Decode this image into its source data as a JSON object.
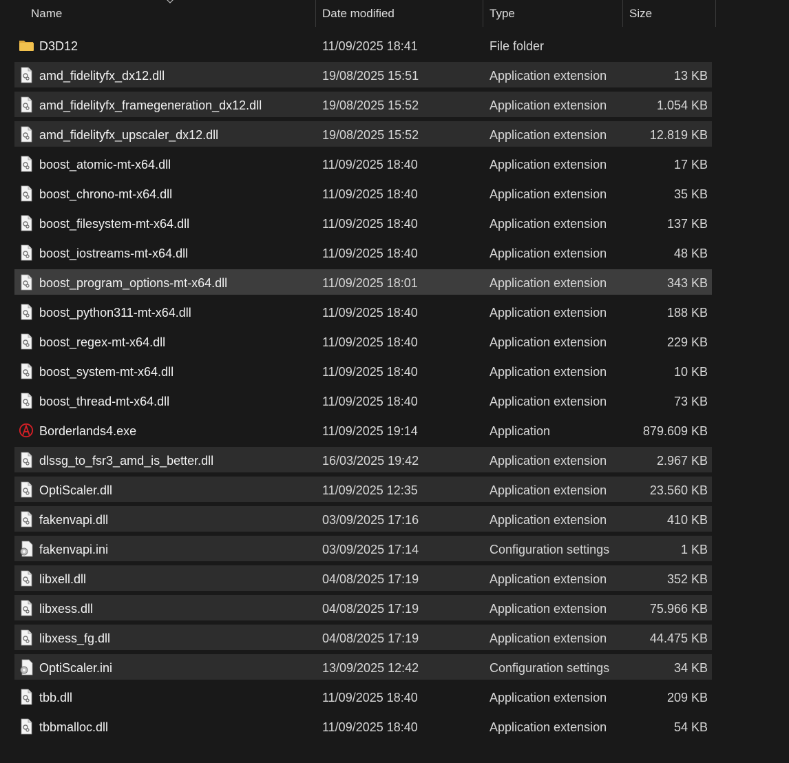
{
  "columns": {
    "name": "Name",
    "date": "Date modified",
    "type": "Type",
    "size": "Size"
  },
  "files": [
    {
      "name": "D3D12",
      "date": "11/09/2025 18:41",
      "type": "File folder",
      "size": "",
      "icon": "folder-icon",
      "state": "normal"
    },
    {
      "name": "amd_fidelityfx_dx12.dll",
      "date": "19/08/2025 15:51",
      "type": "Application extension",
      "size": "13 KB",
      "icon": "dll-file-icon",
      "state": "selected"
    },
    {
      "name": "amd_fidelityfx_framegeneration_dx12.dll",
      "date": "19/08/2025 15:52",
      "type": "Application extension",
      "size": "1.054 KB",
      "icon": "dll-file-icon",
      "state": "selected"
    },
    {
      "name": "amd_fidelityfx_upscaler_dx12.dll",
      "date": "19/08/2025 15:52",
      "type": "Application extension",
      "size": "12.819 KB",
      "icon": "dll-file-icon",
      "state": "selected"
    },
    {
      "name": "boost_atomic-mt-x64.dll",
      "date": "11/09/2025 18:40",
      "type": "Application extension",
      "size": "17 KB",
      "icon": "dll-file-icon",
      "state": "normal"
    },
    {
      "name": "boost_chrono-mt-x64.dll",
      "date": "11/09/2025 18:40",
      "type": "Application extension",
      "size": "35 KB",
      "icon": "dll-file-icon",
      "state": "normal"
    },
    {
      "name": "boost_filesystem-mt-x64.dll",
      "date": "11/09/2025 18:40",
      "type": "Application extension",
      "size": "137 KB",
      "icon": "dll-file-icon",
      "state": "normal"
    },
    {
      "name": "boost_iostreams-mt-x64.dll",
      "date": "11/09/2025 18:40",
      "type": "Application extension",
      "size": "48 KB",
      "icon": "dll-file-icon",
      "state": "normal"
    },
    {
      "name": "boost_program_options-mt-x64.dll",
      "date": "11/09/2025 18:01",
      "type": "Application extension",
      "size": "343 KB",
      "icon": "dll-file-icon",
      "state": "focused"
    },
    {
      "name": "boost_python311-mt-x64.dll",
      "date": "11/09/2025 18:40",
      "type": "Application extension",
      "size": "188 KB",
      "icon": "dll-file-icon",
      "state": "normal"
    },
    {
      "name": "boost_regex-mt-x64.dll",
      "date": "11/09/2025 18:40",
      "type": "Application extension",
      "size": "229 KB",
      "icon": "dll-file-icon",
      "state": "normal"
    },
    {
      "name": "boost_system-mt-x64.dll",
      "date": "11/09/2025 18:40",
      "type": "Application extension",
      "size": "10 KB",
      "icon": "dll-file-icon",
      "state": "normal"
    },
    {
      "name": "boost_thread-mt-x64.dll",
      "date": "11/09/2025 18:40",
      "type": "Application extension",
      "size": "73 KB",
      "icon": "dll-file-icon",
      "state": "normal"
    },
    {
      "name": "Borderlands4.exe",
      "date": "11/09/2025 19:14",
      "type": "Application",
      "size": "879.609 KB",
      "icon": "borderlands-app-icon",
      "state": "normal"
    },
    {
      "name": "dlssg_to_fsr3_amd_is_better.dll",
      "date": "16/03/2025 19:42",
      "type": "Application extension",
      "size": "2.967 KB",
      "icon": "dll-file-icon",
      "state": "selected"
    },
    {
      "name": "OptiScaler.dll",
      "date": "11/09/2025 12:35",
      "type": "Application extension",
      "size": "23.560 KB",
      "icon": "dll-file-icon",
      "state": "selected"
    },
    {
      "name": "fakenvapi.dll",
      "date": "03/09/2025 17:16",
      "type": "Application extension",
      "size": "410 KB",
      "icon": "dll-file-icon",
      "state": "selected"
    },
    {
      "name": "fakenvapi.ini",
      "date": "03/09/2025 17:14",
      "type": "Configuration settings",
      "size": "1 KB",
      "icon": "ini-file-icon",
      "state": "selected"
    },
    {
      "name": "libxell.dll",
      "date": "04/08/2025 17:19",
      "type": "Application extension",
      "size": "352 KB",
      "icon": "dll-file-icon",
      "state": "selected"
    },
    {
      "name": "libxess.dll",
      "date": "04/08/2025 17:19",
      "type": "Application extension",
      "size": "75.966 KB",
      "icon": "dll-file-icon",
      "state": "selected"
    },
    {
      "name": "libxess_fg.dll",
      "date": "04/08/2025 17:19",
      "type": "Application extension",
      "size": "44.475 KB",
      "icon": "dll-file-icon",
      "state": "selected"
    },
    {
      "name": "OptiScaler.ini",
      "date": "13/09/2025 12:42",
      "type": "Configuration settings",
      "size": "34 KB",
      "icon": "ini-file-icon",
      "state": "selected"
    },
    {
      "name": "tbb.dll",
      "date": "11/09/2025 18:40",
      "type": "Application extension",
      "size": "209 KB",
      "icon": "dll-file-icon",
      "state": "normal"
    },
    {
      "name": "tbbmalloc.dll",
      "date": "11/09/2025 18:40",
      "type": "Application extension",
      "size": "54 KB",
      "icon": "dll-file-icon",
      "state": "normal"
    }
  ],
  "colors": {
    "background": "#191919",
    "selected_row": "#2d2d2d",
    "focused_row": "#3d3d3d",
    "folder": "#f2c14e",
    "app_icon_red": "#d61f26"
  }
}
